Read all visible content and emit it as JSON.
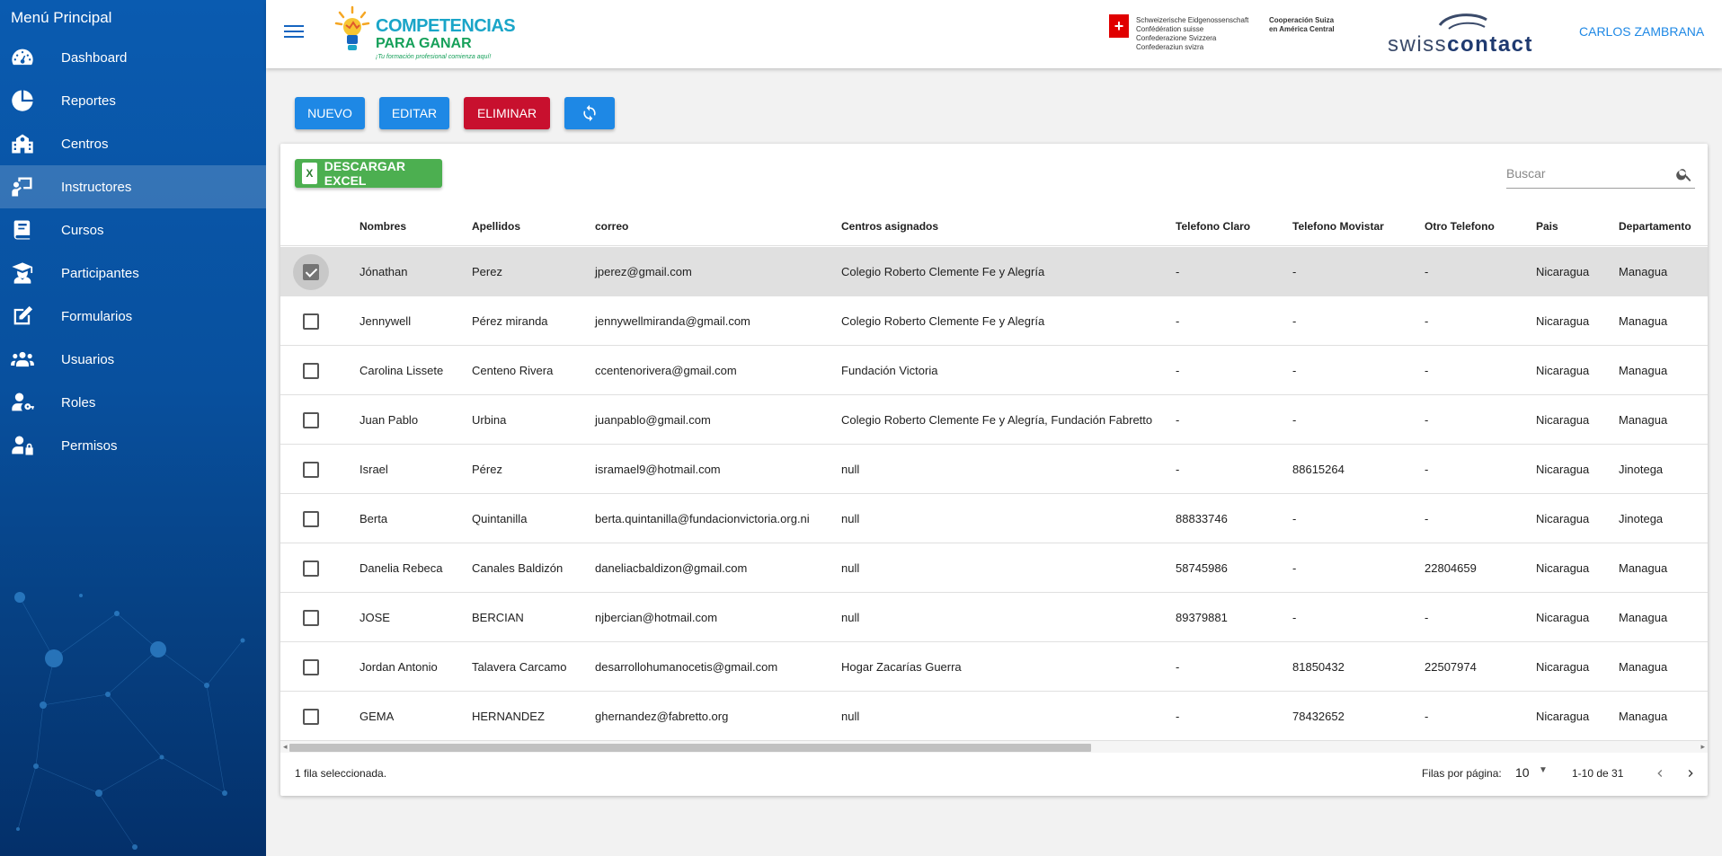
{
  "sidebar": {
    "title": "Menú Principal",
    "items": [
      {
        "label": "Dashboard",
        "icon": "speedometer-icon"
      },
      {
        "label": "Reportes",
        "icon": "pie-chart-icon"
      },
      {
        "label": "Centros",
        "icon": "school-icon"
      },
      {
        "label": "Instructores",
        "icon": "teacher-icon",
        "active": true
      },
      {
        "label": "Cursos",
        "icon": "book-icon"
      },
      {
        "label": "Participantes",
        "icon": "graduate-icon"
      },
      {
        "label": "Formularios",
        "icon": "edit-form-icon"
      },
      {
        "label": "Usuarios",
        "icon": "users-icon"
      },
      {
        "label": "Roles",
        "icon": "user-key-icon"
      },
      {
        "label": "Permisos",
        "icon": "user-lock-icon"
      }
    ]
  },
  "header": {
    "logo_line1": "COMPETENCIAS",
    "logo_line2": "PARA GANAR",
    "logo_tagline": "¡Tu formación profesional comienza aquí!",
    "confed_lines": [
      "Schweizerische Eidgenossenschaft",
      "Confédération suisse",
      "Confederazione Svizzera",
      "Confederaziun svizra"
    ],
    "coop_lines": [
      "Cooperación Suiza",
      "en América Central"
    ],
    "swisscontact_a": "swiss",
    "swisscontact_b": "contact",
    "user": "CARLOS ZAMBRANA"
  },
  "toolbar": {
    "new_label": "NUEVO",
    "edit_label": "EDITAR",
    "delete_label": "ELIMINAR",
    "refresh_icon": "refresh-icon",
    "excel_label": "DESCARGAR EXCEL",
    "excel_icon_text": "X"
  },
  "search": {
    "placeholder": "Buscar"
  },
  "table": {
    "columns": [
      "Nombres",
      "Apellidos",
      "correo",
      "Centros asignados",
      "Telefono Claro",
      "Telefono Movistar",
      "Otro Telefono",
      "Pais",
      "Departamento"
    ],
    "rows": [
      {
        "selected": true,
        "cells": [
          "Jónathan",
          "Perez",
          "jperez@gmail.com",
          "Colegio Roberto Clemente Fe y Alegría",
          "-",
          "-",
          "-",
          "Nicaragua",
          "Managua"
        ]
      },
      {
        "selected": false,
        "cells": [
          "Jennywell",
          "Pérez miranda",
          "jennywellmiranda@gmail.com",
          "Colegio Roberto Clemente Fe y Alegría",
          "-",
          "-",
          "-",
          "Nicaragua",
          "Managua"
        ]
      },
      {
        "selected": false,
        "cells": [
          "Carolina Lissete",
          "Centeno Rivera",
          "ccentenorivera@gmail.com",
          "Fundación Victoria",
          "-",
          "-",
          "-",
          "Nicaragua",
          "Managua"
        ]
      },
      {
        "selected": false,
        "cells": [
          "Juan Pablo",
          "Urbina",
          "juanpablo@gmail.com",
          "Colegio Roberto Clemente Fe y Alegría, Fundación Fabretto",
          "-",
          "-",
          "-",
          "Nicaragua",
          "Managua"
        ]
      },
      {
        "selected": false,
        "cells": [
          "Israel",
          "Pérez",
          "isramael9@hotmail.com",
          "null",
          "-",
          "88615264",
          "-",
          "Nicaragua",
          "Jinotega"
        ]
      },
      {
        "selected": false,
        "cells": [
          "Berta",
          "Quintanilla",
          "berta.quintanilla@fundacionvictoria.org.ni",
          "null",
          "88833746",
          "-",
          "-",
          "Nicaragua",
          "Jinotega"
        ]
      },
      {
        "selected": false,
        "cells": [
          "Danelia Rebeca",
          "Canales Baldizón",
          "daneliacbaldizon@gmail.com",
          "null",
          "58745986",
          "-",
          "22804659",
          "Nicaragua",
          "Managua"
        ]
      },
      {
        "selected": false,
        "cells": [
          "JOSE",
          "BERCIAN",
          "njbercian@hotmail.com",
          "null",
          "89379881",
          "-",
          "-",
          "Nicaragua",
          "Managua"
        ]
      },
      {
        "selected": false,
        "cells": [
          "Jordan Antonio",
          "Talavera Carcamo",
          "desarrollohumanocetis@gmail.com",
          "Hogar Zacarías Guerra",
          "-",
          "81850432",
          "22507974",
          "Nicaragua",
          "Managua"
        ]
      },
      {
        "selected": false,
        "cells": [
          "GEMA",
          "HERNANDEZ",
          "ghernandez@fabretto.org",
          "null",
          "-",
          "78432652",
          "-",
          "Nicaragua",
          "Managua"
        ]
      }
    ]
  },
  "footer": {
    "selection": "1 fila seleccionada.",
    "rows_per_page_label": "Filas por página:",
    "rows_per_page": "10",
    "range": "1-10 de 31"
  }
}
